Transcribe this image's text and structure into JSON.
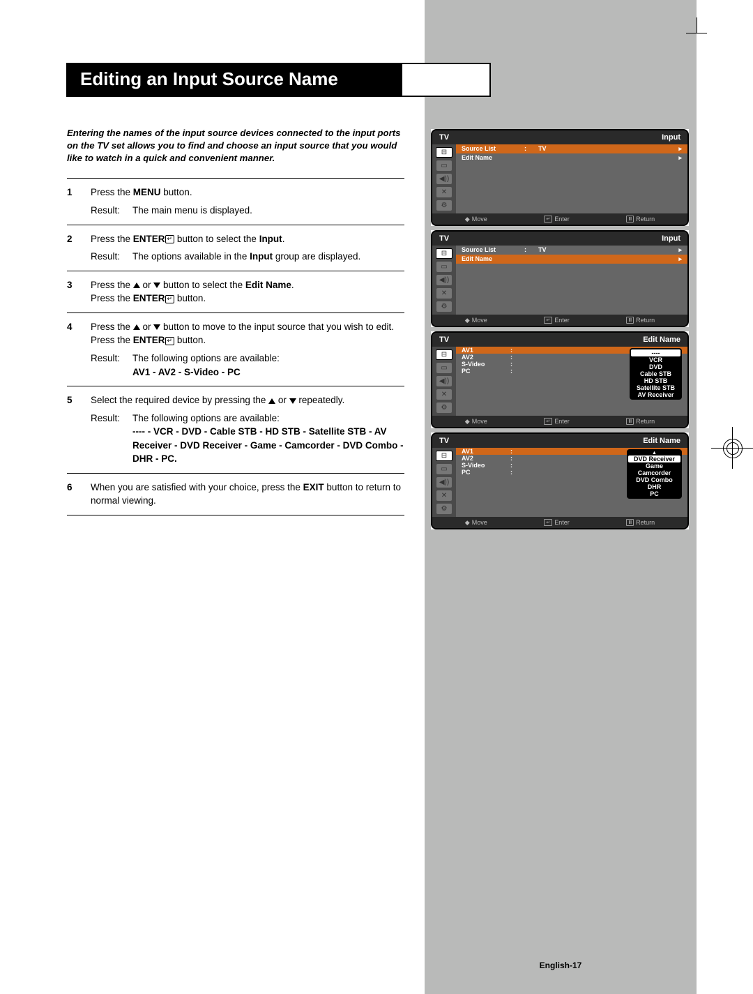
{
  "title": "Editing an Input Source Name",
  "intro": "Entering the names of the input source devices connected to the input ports on the TV set allows you to find and choose an input source that you would like to watch in a quick and convenient manner.",
  "steps": {
    "s1": {
      "num": "1",
      "line1_a": "Press the ",
      "line1_b": "MENU",
      "line1_c": " button.",
      "result_label": "Result:",
      "result": "The main menu is displayed."
    },
    "s2": {
      "num": "2",
      "line1_a": "Press the ",
      "line1_b": "ENTER",
      "line1_c": " button to select the  ",
      "line1_d": "Input",
      "line1_e": ".",
      "result_label": "Result:",
      "result_a": "The options available in the ",
      "result_b": "Input",
      "result_c": " group are displayed."
    },
    "s3": {
      "num": "3",
      "line1_a": "Press the ",
      "line1_b": " or ",
      "line1_c": " button to select the ",
      "line1_d": "Edit Name",
      "line1_e": ".",
      "line2_a": "Press the ",
      "line2_b": "ENTER",
      "line2_c": " button."
    },
    "s4": {
      "num": "4",
      "line1_a": "Press the ",
      "line1_b": " or ",
      "line1_c": " button to move to the input source that you wish to edit.",
      "line2_a": "Press the ",
      "line2_b": "ENTER",
      "line2_c": " button.",
      "result_label": "Result:",
      "result": "The following options are available:",
      "options": "AV1 - AV2 - S-Video - PC"
    },
    "s5": {
      "num": "5",
      "line1_a": "Select the required device by pressing the ",
      "line1_b": " or ",
      "line1_c": " repeatedly.",
      "result_label": "Result:",
      "result": "The following options are available:",
      "options": "---- - VCR - DVD - Cable STB - HD STB - Satellite STB - AV Receiver - DVD Receiver - Game - Camcorder - DVD Combo - DHR - PC."
    },
    "s6": {
      "num": "6",
      "line1_a": "When you are satisfied with your choice, press the ",
      "line1_b": "EXIT",
      "line1_c": " button to return to normal viewing."
    }
  },
  "osd": {
    "footer": {
      "move": "Move",
      "enter": "Enter",
      "return": "Return"
    },
    "m1": {
      "title_left": "TV",
      "title_right": "Input",
      "rows": [
        {
          "label": "Source List",
          "sep": ":",
          "val": "TV",
          "hl": true
        },
        {
          "label": "Edit Name",
          "sep": "",
          "val": "",
          "hl": false
        }
      ]
    },
    "m2": {
      "title_left": "TV",
      "title_right": "Input",
      "rows": [
        {
          "label": "Source List",
          "sep": ":",
          "val": "TV",
          "hl": false
        },
        {
          "label": "Edit Name",
          "sep": "",
          "val": "",
          "hl": true
        }
      ]
    },
    "m3": {
      "title_left": "TV",
      "title_right": "Edit Name",
      "rows": [
        {
          "label": "AV1",
          "sep": ":",
          "hl": true
        },
        {
          "label": "AV2",
          "sep": ":",
          "hl": false
        },
        {
          "label": "S-Video",
          "sep": ":",
          "hl": false
        },
        {
          "label": "PC",
          "sep": ":",
          "hl": false
        }
      ],
      "dropdown": [
        "----",
        "VCR",
        "DVD",
        "Cable STB",
        "HD STB",
        "Satellite STB",
        "AV Receiver"
      ],
      "dropdown_sel": 0
    },
    "m4": {
      "title_left": "TV",
      "title_right": "Edit Name",
      "rows": [
        {
          "label": "AV1",
          "sep": ":",
          "hl": true
        },
        {
          "label": "AV2",
          "sep": ":",
          "hl": false
        },
        {
          "label": "S-Video",
          "sep": ":",
          "hl": false
        },
        {
          "label": "PC",
          "sep": ":",
          "hl": false
        }
      ],
      "dropdown_top_arrow": "▲",
      "dropdown": [
        "DVD Receiver",
        "Game",
        "Camcorder",
        "DVD Combo",
        "DHR",
        "PC"
      ],
      "dropdown_sel": 0
    }
  },
  "page_num": "English-17"
}
